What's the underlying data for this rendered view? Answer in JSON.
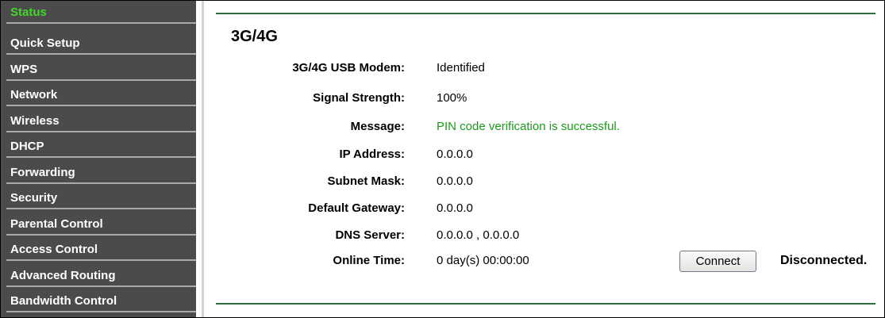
{
  "sidebar": {
    "items": [
      {
        "label": "Status",
        "active": true
      },
      {
        "label": "Quick Setup",
        "active": false
      },
      {
        "label": "WPS",
        "active": false
      },
      {
        "label": "Network",
        "active": false
      },
      {
        "label": "Wireless",
        "active": false
      },
      {
        "label": "DHCP",
        "active": false
      },
      {
        "label": "Forwarding",
        "active": false
      },
      {
        "label": "Security",
        "active": false
      },
      {
        "label": "Parental Control",
        "active": false
      },
      {
        "label": "Access Control",
        "active": false
      },
      {
        "label": "Advanced Routing",
        "active": false
      },
      {
        "label": "Bandwidth Control",
        "active": false
      }
    ]
  },
  "main": {
    "title": "3G/4G",
    "rows": [
      {
        "label": "3G/4G USB Modem:",
        "value": "Identified"
      },
      {
        "label": "Signal Strength:",
        "value": "100%"
      },
      {
        "label": "Message:",
        "value": "PIN code verification is successful."
      },
      {
        "label": "IP Address:",
        "value": "0.0.0.0"
      },
      {
        "label": "Subnet Mask:",
        "value": "0.0.0.0"
      },
      {
        "label": "Default Gateway:",
        "value": "0.0.0.0"
      },
      {
        "label": "DNS Server:",
        "value": "0.0.0.0 , 0.0.0.0"
      },
      {
        "label": "Online Time:",
        "value": "0 day(s) 00:00:00"
      }
    ],
    "connect_label": "Connect",
    "connection_status": "Disconnected."
  },
  "colors": {
    "sidebar_bg": "#4b4b4b",
    "active_item": "#44d62c",
    "success_text": "#1c9a1c",
    "rule": "#2f6b3f"
  }
}
